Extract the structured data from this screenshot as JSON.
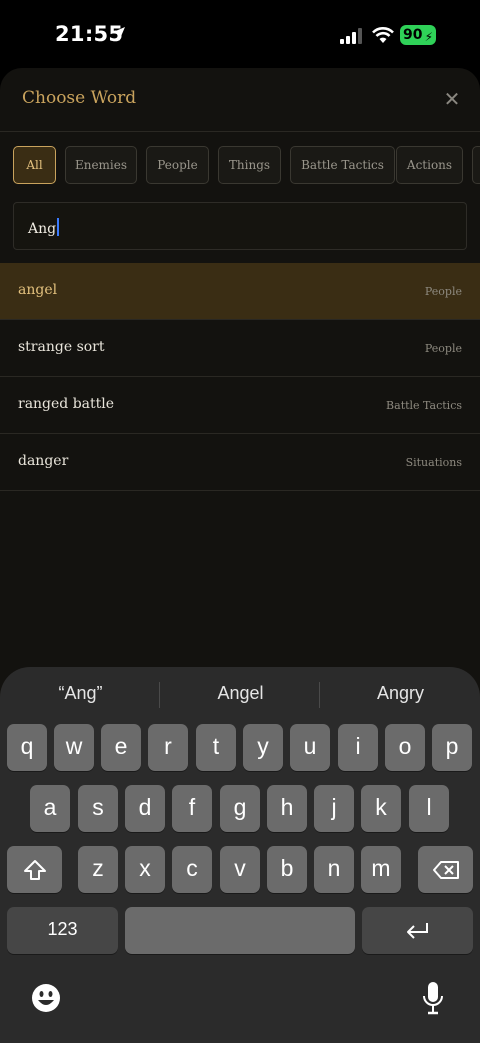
{
  "status_bar": {
    "time": "21:55",
    "battery": "90"
  },
  "sheet": {
    "title": "Choose Word",
    "filters": [
      {
        "label": "All",
        "active": true
      },
      {
        "label": "Enemies",
        "active": false
      },
      {
        "label": "People",
        "active": false
      },
      {
        "label": "Things",
        "active": false
      },
      {
        "label": "Battle Tactics",
        "active": false
      },
      {
        "label": "Actions",
        "active": false
      }
    ],
    "search": {
      "value": "Ang"
    },
    "results": [
      {
        "word": "angel",
        "category": "People",
        "selected": true
      },
      {
        "word": "strange sort",
        "category": "People",
        "selected": false
      },
      {
        "word": "ranged battle",
        "category": "Battle Tactics",
        "selected": false
      },
      {
        "word": "danger",
        "category": "Situations",
        "selected": false
      }
    ]
  },
  "keyboard": {
    "suggestions": [
      "“Ang”",
      "Angel",
      "Angry"
    ],
    "row1": [
      "q",
      "w",
      "e",
      "r",
      "t",
      "y",
      "u",
      "i",
      "o",
      "p"
    ],
    "row2": [
      "a",
      "s",
      "d",
      "f",
      "g",
      "h",
      "j",
      "k",
      "l"
    ],
    "row3": [
      "z",
      "x",
      "c",
      "v",
      "b",
      "n",
      "m"
    ],
    "numbers_key": "123",
    "icons": [
      "shift-icon",
      "backspace-icon",
      "return-icon",
      "emoji-icon",
      "microphone-icon"
    ]
  },
  "colors": {
    "accent": "#c9a35d",
    "selected_bg": "#3a2d14",
    "battery": "#2fd158"
  }
}
